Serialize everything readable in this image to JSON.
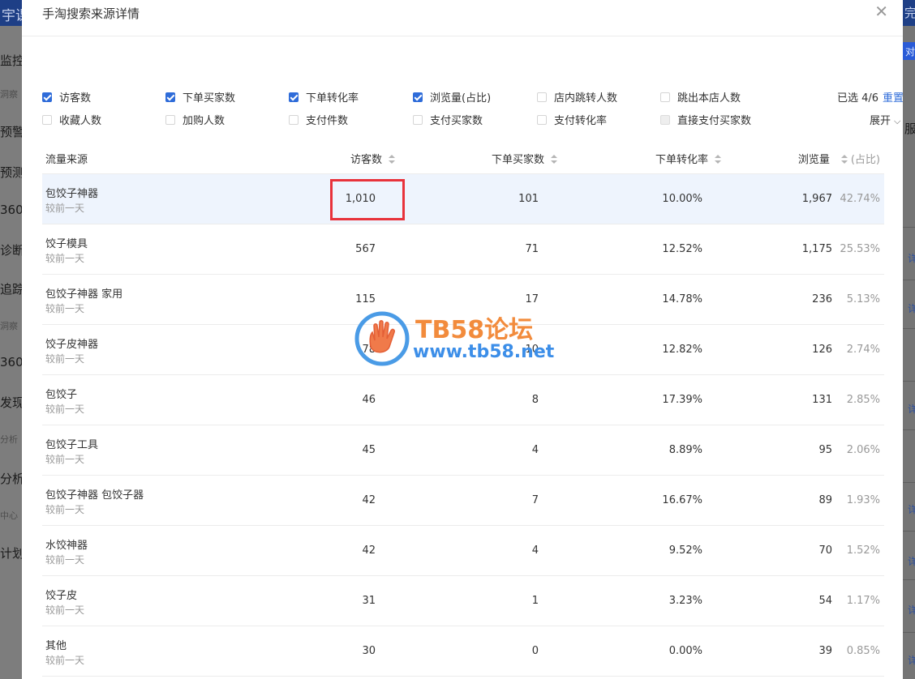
{
  "background": {
    "left_topbar": "宇课",
    "left_items": [
      {
        "text": "监控",
        "size": "big"
      },
      {
        "text": "洞察",
        "size": "small"
      },
      {
        "text": "预警",
        "size": "big"
      },
      {
        "text": "预测",
        "size": "big"
      },
      {
        "text": "360",
        "size": "big"
      },
      {
        "text": "诊断",
        "size": "big"
      },
      {
        "text": "追踪",
        "size": "big"
      },
      {
        "text": "洞察",
        "size": "small"
      },
      {
        "text": "360",
        "size": "big"
      },
      {
        "text": "发现",
        "size": "big"
      },
      {
        "text": "分析",
        "size": "small"
      },
      {
        "text": "分析",
        "size": "big"
      },
      {
        "text": "中心",
        "size": "small"
      },
      {
        "text": "计划",
        "size": "big"
      }
    ],
    "right_topbar": "完",
    "right_button": "对",
    "right_item": "服",
    "right_links": [
      "详",
      "详",
      "详",
      "详",
      "详",
      "详",
      "详"
    ]
  },
  "modal": {
    "title": "手淘搜索来源详情",
    "close_icon": "close-icon"
  },
  "metrics": [
    {
      "label": "访客数",
      "state": "checked"
    },
    {
      "label": "下单买家数",
      "state": "checked"
    },
    {
      "label": "下单转化率",
      "state": "checked"
    },
    {
      "label": "浏览量(占比)",
      "state": "checked"
    },
    {
      "label": "店内跳转人数",
      "state": "unchecked"
    },
    {
      "label": "跳出本店人数",
      "state": "unchecked"
    },
    {
      "label": "收藏人数",
      "state": "unchecked"
    },
    {
      "label": "加购人数",
      "state": "unchecked"
    },
    {
      "label": "支付件数",
      "state": "unchecked"
    },
    {
      "label": "支付买家数",
      "state": "unchecked"
    },
    {
      "label": "支付转化率",
      "state": "unchecked"
    },
    {
      "label": "直接支付买家数",
      "state": "disabled"
    }
  ],
  "selection": {
    "info": "已选 4/6",
    "reset": "重置",
    "expand": "展开",
    "expand_icon": "chevron-down-icon"
  },
  "table": {
    "headers": {
      "source": "流量来源",
      "visitors": "访客数",
      "buyers": "下单买家数",
      "rate": "下单转化率",
      "views": "浏览量",
      "share": "(占比)"
    },
    "rows": [
      {
        "name": "包饺子神器",
        "sub": "较前一天",
        "visitors": "1,010",
        "buyers": "101",
        "rate": "10.00%",
        "views": "1,967",
        "share": "42.74%"
      },
      {
        "name": "饺子模具",
        "sub": "较前一天",
        "visitors": "567",
        "buyers": "71",
        "rate": "12.52%",
        "views": "1,175",
        "share": "25.53%"
      },
      {
        "name": "包饺子神器 家用",
        "sub": "较前一天",
        "visitors": "115",
        "buyers": "17",
        "rate": "14.78%",
        "views": "236",
        "share": "5.13%"
      },
      {
        "name": "饺子皮神器",
        "sub": "较前一天",
        "visitors": "78",
        "buyers": "10",
        "rate": "12.82%",
        "views": "126",
        "share": "2.74%"
      },
      {
        "name": "包饺子",
        "sub": "较前一天",
        "visitors": "46",
        "buyers": "8",
        "rate": "17.39%",
        "views": "131",
        "share": "2.85%"
      },
      {
        "name": "包饺子工具",
        "sub": "较前一天",
        "visitors": "45",
        "buyers": "4",
        "rate": "8.89%",
        "views": "95",
        "share": "2.06%"
      },
      {
        "name": "包饺子神器 包饺子器",
        "sub": "较前一天",
        "visitors": "42",
        "buyers": "7",
        "rate": "16.67%",
        "views": "89",
        "share": "1.93%"
      },
      {
        "name": "水饺神器",
        "sub": "较前一天",
        "visitors": "42",
        "buyers": "4",
        "rate": "9.52%",
        "views": "70",
        "share": "1.52%"
      },
      {
        "name": "饺子皮",
        "sub": "较前一天",
        "visitors": "31",
        "buyers": "1",
        "rate": "3.23%",
        "views": "54",
        "share": "1.17%"
      },
      {
        "name": "其他",
        "sub": "较前一天",
        "visitors": "30",
        "buyers": "0",
        "rate": "0.00%",
        "views": "39",
        "share": "0.85%"
      }
    ]
  },
  "watermark": {
    "title": "TB58论坛",
    "url": "www.tb58.net",
    "logo_icon": "hand-logo-icon"
  },
  "colors": {
    "accent": "#2f6cd9",
    "highlight_row": "#eef4fd",
    "red_box": "#e8323b",
    "wm_orange": "#f28b3c",
    "wm_blue": "#3c8ee8"
  }
}
